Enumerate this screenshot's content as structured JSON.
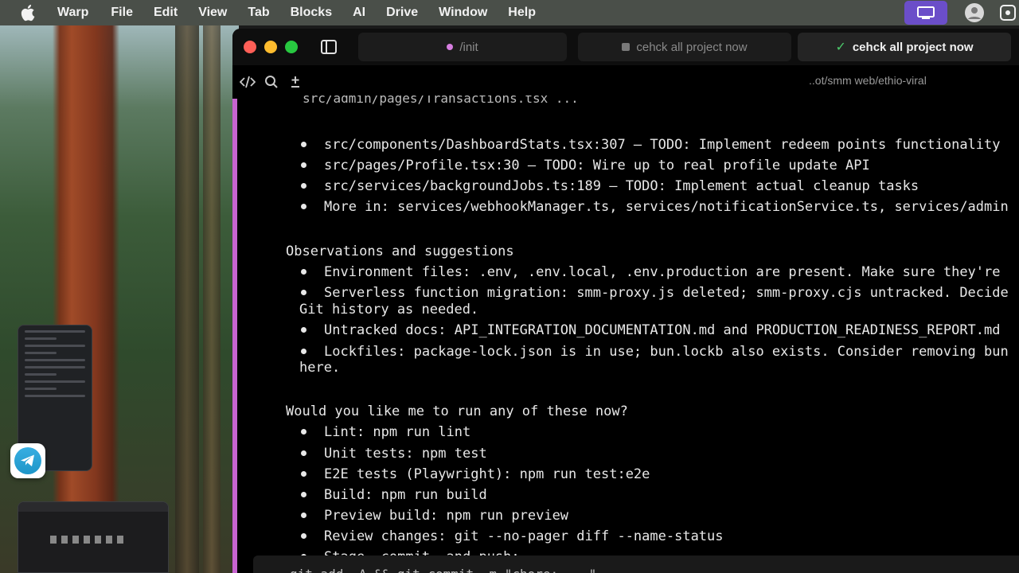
{
  "menubar": {
    "app": "Warp",
    "items": [
      "File",
      "Edit",
      "View",
      "Tab",
      "Blocks",
      "AI",
      "Drive",
      "Window",
      "Help"
    ]
  },
  "tabs": [
    {
      "label": "/init",
      "indicator": "pink-dot"
    },
    {
      "label": "cehck all project now",
      "indicator": "grey-square"
    },
    {
      "label": "cehck all project now",
      "indicator": "check",
      "active": true
    }
  ],
  "toolbar": {
    "path": "..ot/smm web/ethio-viral"
  },
  "terminal": {
    "lines": [
      {
        "type": "bullet",
        "text": "src/components/DashboardStats.tsx:307 — TODO: Implement redeem points functionality"
      },
      {
        "type": "bullet",
        "text": "src/pages/Profile.tsx:30 — TODO: Wire up to real profile update API"
      },
      {
        "type": "bullet",
        "text": "src/services/backgroundJobs.ts:189 — TODO: Implement actual cleanup tasks"
      },
      {
        "type": "bullet",
        "text": "More in: services/webhookManager.ts, services/notificationService.ts, services/admin"
      },
      {
        "type": "heading",
        "text": "Observations and suggestions"
      },
      {
        "type": "bullet",
        "text": "Environment files: .env, .env.local, .env.production are present. Make sure they're"
      },
      {
        "type": "bullet",
        "text": "Serverless function migration: smm-proxy.js deleted; smm-proxy.cjs untracked. Decide"
      },
      {
        "type": "cont",
        "text": "Git history as needed."
      },
      {
        "type": "bullet",
        "text": "Untracked docs: API_INTEGRATION_DOCUMENTATION.md and PRODUCTION_READINESS_REPORT.md"
      },
      {
        "type": "bullet",
        "text": "Lockfiles: package-lock.json is in use; bun.lockb also exists. Consider removing bun"
      },
      {
        "type": "cont",
        "text": "here."
      },
      {
        "type": "heading",
        "text": "Would you like me to run any of these now?"
      },
      {
        "type": "bullet",
        "text": "Lint: npm run lint"
      },
      {
        "type": "bullet",
        "text": "Unit tests: npm test"
      },
      {
        "type": "bullet",
        "text": "E2E tests (Playwright): npm run test:e2e"
      },
      {
        "type": "bullet",
        "text": "Build: npm run build"
      },
      {
        "type": "bullet",
        "text": "Preview build: npm run preview"
      },
      {
        "type": "bullet",
        "text": "Review changes: git --no-pager diff --name-status"
      },
      {
        "type": "bullet",
        "text": "Stage, commit, and push:"
      }
    ]
  },
  "colors": {
    "accent": "#c764d0",
    "active_tab_check": "#4cc96a",
    "menubar_indicator": "#6b4ec9"
  }
}
